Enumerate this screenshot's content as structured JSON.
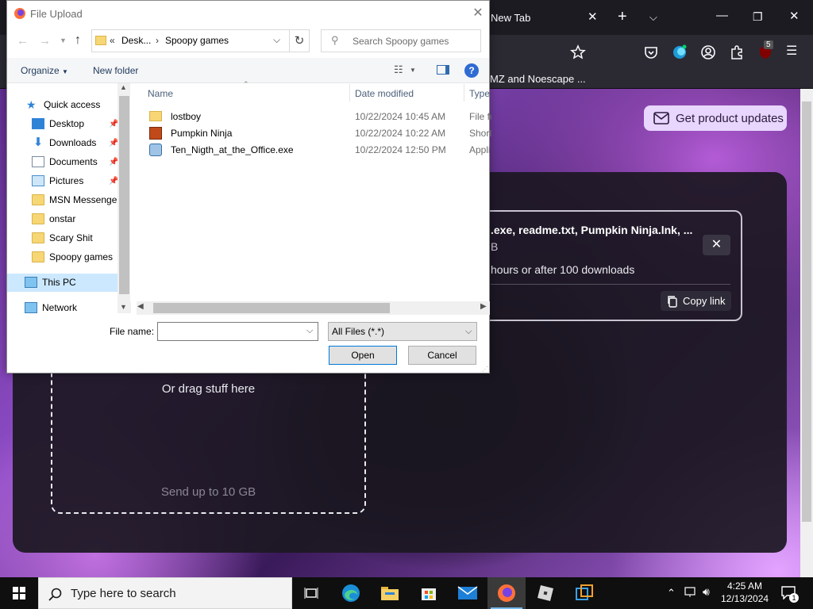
{
  "browser": {
    "tab_title": "New Tab",
    "bookmark_text": "MZ and Noescape ...",
    "extension_badge": "5",
    "updates_button": "Get product updates",
    "drag_text": "Or drag stuff here",
    "send_limit_text": "Send up to 10 GB",
    "share_card": {
      "files_text": ".exe, readme.txt, Pumpkin Ninja.lnk, ...",
      "size_text": "B",
      "expire_text": "hours or after 100 downloads",
      "copy_link": "Copy link"
    }
  },
  "dialog": {
    "title": "File Upload",
    "address": {
      "prefix": "«",
      "crumb1": "Desk...",
      "sep": "›",
      "crumb2": "Spoopy games"
    },
    "search_placeholder": "Search Spoopy games",
    "organize": "Organize",
    "new_folder": "New folder",
    "nav": {
      "quick_access": "Quick access",
      "items": [
        "Desktop",
        "Downloads",
        "Documents",
        "Pictures",
        "MSN Messenger",
        "onstar",
        "Scary Shit",
        "Spoopy games"
      ],
      "this_pc": "This PC",
      "network": "Network"
    },
    "columns": {
      "name": "Name",
      "date": "Date modified",
      "type": "Type"
    },
    "files": [
      {
        "name": "lostboy",
        "date": "10/22/2024 10:45 AM",
        "type": "File fo"
      },
      {
        "name": "Pumpkin Ninja",
        "date": "10/22/2024 10:22 AM",
        "type": "Short"
      },
      {
        "name": "Ten_Nigth_at_the_Office.exe",
        "date": "10/22/2024 12:50 PM",
        "type": "Appli"
      }
    ],
    "file_name_label": "File name:",
    "file_name_value": "",
    "filter": "All Files (*.*)",
    "open": "Open",
    "cancel": "Cancel"
  },
  "taskbar": {
    "search_placeholder": "Type here to search",
    "time": "4:25 AM",
    "date": "12/13/2024",
    "notification_count": "1"
  }
}
